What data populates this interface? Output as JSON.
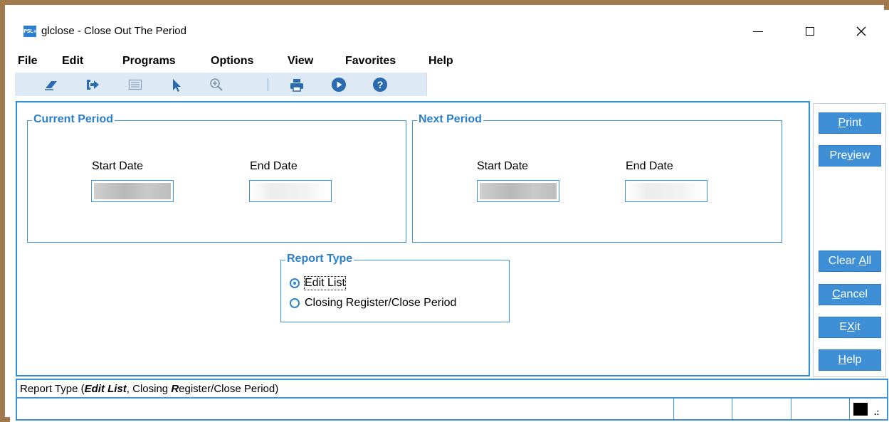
{
  "window": {
    "title": "glclose - Close Out The Period",
    "app_icon": "PSL+"
  },
  "menu": {
    "items": [
      "File",
      "Edit",
      "Programs",
      "Options",
      "View",
      "Favorites",
      "Help"
    ]
  },
  "toolbar": {
    "icons": [
      "eraser-icon",
      "exit-arrow-icon",
      "list-icon",
      "pointer-icon",
      "zoom-in-icon",
      "print-icon",
      "play-icon",
      "help-icon"
    ],
    "accent_color": "#2a6bb0"
  },
  "current_period": {
    "label": "Current Period",
    "start_label": "Start Date",
    "end_label": "End Date",
    "start_value": "",
    "end_value": ""
  },
  "next_period": {
    "label": "Next Period",
    "start_label": "Start Date",
    "end_label": "End Date",
    "start_value": "",
    "end_value": ""
  },
  "report_type": {
    "label": "Report Type",
    "options": [
      "Edit List",
      "Closing Register/Close Period"
    ],
    "selected": "Edit List"
  },
  "side_buttons": {
    "print": {
      "pre": "",
      "u": "P",
      "post": "rint"
    },
    "preview": {
      "pre": "Pre",
      "u": "v",
      "post": "iew"
    },
    "clear_all": {
      "pre": "Clear ",
      "u": "A",
      "post": "ll"
    },
    "cancel": {
      "pre": "",
      "u": "C",
      "post": "ancel"
    },
    "exit": {
      "pre": "E",
      "u": "X",
      "post": "it"
    },
    "help": {
      "pre": "",
      "u": "H",
      "post": "elp"
    }
  },
  "status": {
    "prefix": "Report Type (",
    "opt1_bold": "Edit List",
    "sep": ", Closing ",
    "r_bold": "R",
    "rest": "egister/Close Period)"
  },
  "colors": {
    "frame": "#a07a4c",
    "accent": "#3e8fd6",
    "group_label": "#2a7fc9"
  }
}
